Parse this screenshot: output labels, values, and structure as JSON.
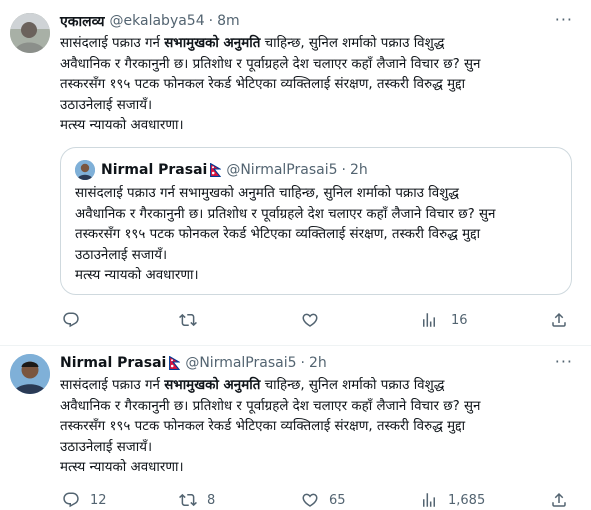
{
  "tweet1": {
    "name": "एकालव्य",
    "handle": "@ekalabya54",
    "sep": "·",
    "time": "8m",
    "more": "···",
    "lines": [
      [
        "सासंदलाई पक्राउ गर्न ",
        "सभामुखको अनुमति",
        " चाहिन्छ, सुनिल शर्माको पक्राउ विशुद्ध"
      ],
      [
        "अवैधानिक र गैरकानुनी छ। प्रतिशोध र पूर्वाग्रहले देश चलाएर कहाँ लैजाने विचार छ? सुन",
        "",
        ""
      ],
      [
        "तस्करसँग १९५ पटक फोनकल रेकर्ड भेटिएका व्यक्तिलाई संरक्षण, तस्करी विरुद्ध मुद्दा",
        "",
        ""
      ],
      [
        "उठाउनेलाई सजायँ।",
        "",
        ""
      ],
      [
        "मत्स्य न्यायको अवधारणा।",
        "",
        ""
      ]
    ],
    "actions": {
      "reply": "",
      "retweet": "",
      "like": "",
      "views": "16",
      "share": ""
    }
  },
  "quote": {
    "name": "Nirmal Prasai",
    "handle": "@NirmalPrasai5",
    "sep": "·",
    "time": "2h",
    "lines": [
      "सासंदलाई पक्राउ गर्न सभामुखको अनुमति चाहिन्छ, सुनिल शर्माको पक्राउ विशुद्ध",
      "अवैधानिक र गैरकानुनी छ। प्रतिशोध र पूर्वाग्रहले देश चलाएर कहाँ लैजाने विचार छ? सुन",
      "तस्करसँग १९५ पटक फोनकल रेकर्ड भेटिएका व्यक्तिलाई संरक्षण, तस्करी विरुद्ध मुद्दा",
      "उठाउनेलाई सजायँ।",
      "मत्स्य न्यायको अवधारणा।"
    ]
  },
  "tweet2": {
    "name": "Nirmal Prasai",
    "handle": "@NirmalPrasai5",
    "sep": "·",
    "time": "2h",
    "more": "···",
    "lines": [
      [
        "सासंदलाई पक्राउ गर्न ",
        "सभामुखको अनुमति",
        " चाहिन्छ, सुनिल शर्माको पक्राउ विशुद्ध"
      ],
      [
        "अवैधानिक र गैरकानुनी छ। प्रतिशोध र पूर्वाग्रहले देश चलाएर कहाँ लैजाने विचार छ? सुन",
        "",
        ""
      ],
      [
        "तस्करसँग १९५ पटक फोनकल रेकर्ड भेटिएका व्यक्तिलाई संरक्षण, तस्करी विरुद्ध मुद्दा",
        "",
        ""
      ],
      [
        "उठाउनेलाई सजायँ।",
        "",
        ""
      ],
      [
        "मत्स्य न्यायको अवधारणा।",
        "",
        ""
      ]
    ],
    "actions": {
      "reply": "12",
      "retweet": "8",
      "like": "65",
      "views": "1,685",
      "share": ""
    }
  },
  "icons": {
    "reply": "reply-icon",
    "retweet": "retweet-icon",
    "like": "heart-icon",
    "views": "views-icon",
    "share": "share-icon",
    "flag": "nepal-flag-icon",
    "more": "more-icon"
  },
  "colors": {
    "text": "#0f1419",
    "secondary": "#536471",
    "border": "#cfd9de",
    "flag_red": "#dc143c",
    "flag_blue": "#003893"
  }
}
